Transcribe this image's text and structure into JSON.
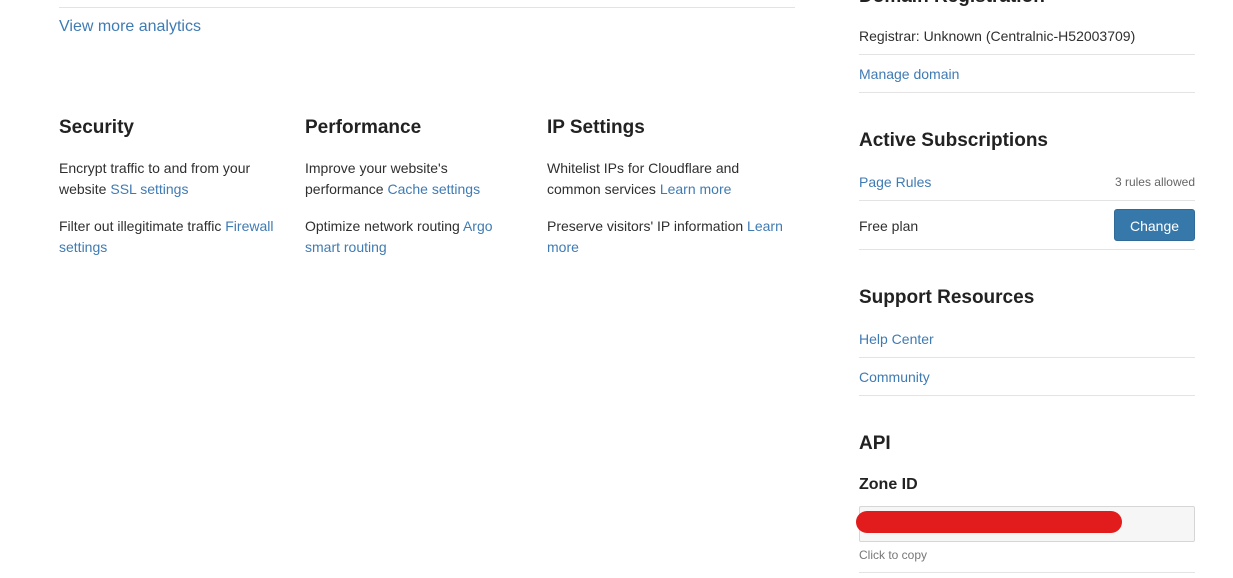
{
  "analytics": {
    "view_more_label": "View more analytics"
  },
  "features": {
    "security": {
      "title": "Security",
      "item1_text": "Encrypt traffic to and from your website ",
      "item1_link": "SSL settings",
      "item2_text": "Filter out illegitimate traffic ",
      "item2_link": "Firewall settings"
    },
    "performance": {
      "title": "Performance",
      "item1_text": "Improve your website's performance ",
      "item1_link": "Cache settings",
      "item2_text": "Optimize network routing ",
      "item2_link": "Argo smart routing"
    },
    "ip_settings": {
      "title": "IP Settings",
      "item1_text": "Whitelist IPs for Cloudflare and common services ",
      "item1_link": "Learn more",
      "item2_text": "Preserve visitors' IP information ",
      "item2_link": "Learn more"
    }
  },
  "domain_registration": {
    "title": "Domain Registration",
    "registrar": "Registrar: Unknown (Centralnic-H52003709)",
    "manage_link": "Manage domain"
  },
  "subscriptions": {
    "title": "Active Subscriptions",
    "page_rules_label": "Page Rules",
    "rules_allowed": "3 rules allowed",
    "plan_label": "Free plan",
    "change_button": "Change"
  },
  "support": {
    "title": "Support Resources",
    "help_center": "Help Center",
    "community": "Community"
  },
  "api": {
    "title": "API",
    "zone_id_label": "Zone ID",
    "click_to_copy": "Click to copy"
  },
  "colors": {
    "link": "#3f7bb3",
    "button": "#3778ab",
    "redaction": "#e21c1c"
  }
}
